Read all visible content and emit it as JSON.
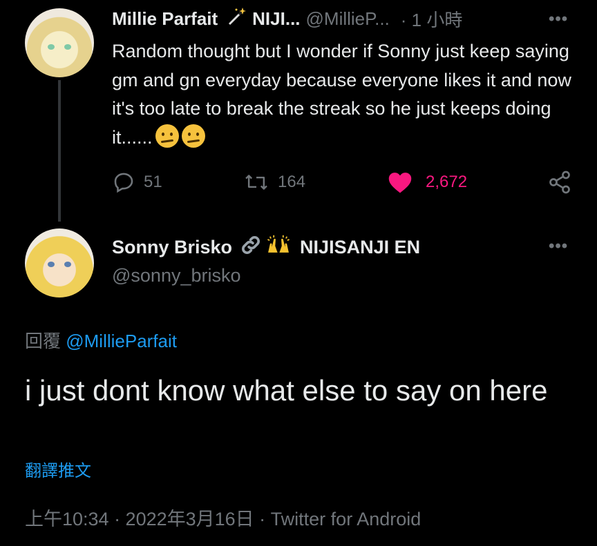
{
  "parent_tweet": {
    "display_name": "Millie Parfait",
    "name_suffix": "NIJI...",
    "handle": "@MillieP...",
    "time": "· 1 小時",
    "more": "•••",
    "text": "Random thought but I wonder if Sonny just keep saying gm and gn everyday because everyone likes it and now it's too late to break the streak so he just keeps doing it......",
    "emojis": [
      "thinking-face",
      "thinking-face"
    ],
    "replies": "51",
    "retweets": "164",
    "likes": "2,672",
    "like_color": "#f91880"
  },
  "reply_tweet": {
    "display_name": "Sonny Brisko",
    "name_suffix": "NIJISANJI EN",
    "handle": "@sonny_brisko",
    "more": "•••",
    "replying_label": "回覆",
    "replying_to": "@MillieParfait",
    "text": "i just dont know what else to say on here",
    "translate_label": "翻譯推文",
    "timestamp": "上午10:34 · 2022年3月16日 · Twitter for Android"
  },
  "colors": {
    "background": "#000000",
    "text": "#e7e9ea",
    "muted": "#71767b",
    "link": "#1d9bf0"
  }
}
